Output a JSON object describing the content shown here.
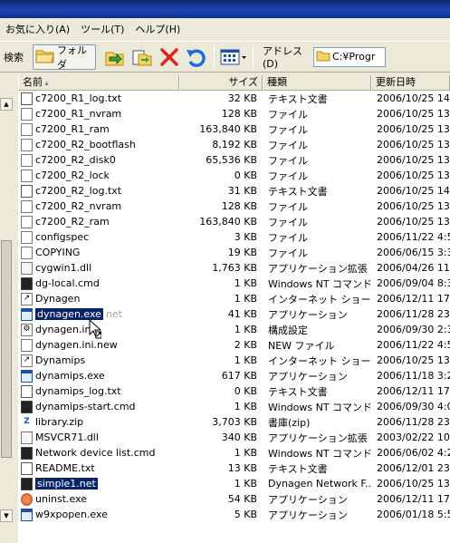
{
  "menu": [
    "お気に入り(A)",
    "ツール(T)",
    "ヘルプ(H)"
  ],
  "toolbar": {
    "search_label": "検索",
    "folders_label": "フォルダ",
    "address_label": "アドレス(D)",
    "address_value": "C:¥Progr"
  },
  "columns": {
    "name": "名前",
    "size": "サイズ",
    "type": "種類",
    "date": "更新日時"
  },
  "files": [
    {
      "name": "c7200_R1_log.txt",
      "size": "32 KB",
      "type": "テキスト文書",
      "date": "2006/10/25 14",
      "icon": "txt"
    },
    {
      "name": "c7200_R1_nvram",
      "size": "128 KB",
      "type": "ファイル",
      "date": "2006/10/25 13",
      "icon": "gen"
    },
    {
      "name": "c7200_R1_ram",
      "size": "163,840 KB",
      "type": "ファイル",
      "date": "2006/10/25 13",
      "icon": "gen"
    },
    {
      "name": "c7200_R2_bootflash",
      "size": "8,192 KB",
      "type": "ファイル",
      "date": "2006/10/25 13",
      "icon": "gen"
    },
    {
      "name": "c7200_R2_disk0",
      "size": "65,536 KB",
      "type": "ファイル",
      "date": "2006/10/25 13",
      "icon": "gen"
    },
    {
      "name": "c7200_R2_lock",
      "size": "0 KB",
      "type": "ファイル",
      "date": "2006/10/25 13",
      "icon": "gen"
    },
    {
      "name": "c7200_R2_log.txt",
      "size": "31 KB",
      "type": "テキスト文書",
      "date": "2006/10/25 14",
      "icon": "txt"
    },
    {
      "name": "c7200_R2_nvram",
      "size": "128 KB",
      "type": "ファイル",
      "date": "2006/10/25 13",
      "icon": "gen"
    },
    {
      "name": "c7200_R2_ram",
      "size": "163,840 KB",
      "type": "ファイル",
      "date": "2006/10/25 13",
      "icon": "gen"
    },
    {
      "name": "configspec",
      "size": "3 KB",
      "type": "ファイル",
      "date": "2006/11/22 4:5",
      "icon": "gen"
    },
    {
      "name": "COPYING",
      "size": "19 KB",
      "type": "ファイル",
      "date": "2006/06/15 3:3",
      "icon": "gen"
    },
    {
      "name": "cygwin1.dll",
      "size": "1,763 KB",
      "type": "アプリケーション拡張",
      "date": "2006/04/26 11",
      "icon": "dll"
    },
    {
      "name": "dg-local.cmd",
      "size": "1 KB",
      "type": "Windows NT コマンド...",
      "date": "2006/09/04 8:3",
      "icon": "cmd"
    },
    {
      "name": "Dynagen",
      "size": "1 KB",
      "type": "インターネット ショート...",
      "date": "2006/12/11 17",
      "icon": "lnk"
    },
    {
      "name": "dynagen.exe",
      "ghost": "net",
      "size": "41 KB",
      "type": "アプリケーション",
      "date": "2006/11/28 23",
      "icon": "app",
      "selected": true
    },
    {
      "name": "dynagen.ini",
      "size": "1 KB",
      "type": "構成設定",
      "date": "2006/09/30 2:3",
      "icon": "cfg"
    },
    {
      "name": "dynagen.ini.new",
      "size": "2 KB",
      "type": "NEW ファイル",
      "date": "2006/11/22 4:5",
      "icon": "gen"
    },
    {
      "name": "Dynamips",
      "size": "1 KB",
      "type": "インターネット ショート...",
      "date": "2006/10/25 13",
      "icon": "lnk"
    },
    {
      "name": "dynamips.exe",
      "size": "617 KB",
      "type": "アプリケーション",
      "date": "2006/11/18 3:2",
      "icon": "app"
    },
    {
      "name": "dynamips_log.txt",
      "size": "0 KB",
      "type": "テキスト文書",
      "date": "2006/12/11 17",
      "icon": "txt"
    },
    {
      "name": "dynamips-start.cmd",
      "size": "1 KB",
      "type": "Windows NT コマンド...",
      "date": "2006/09/30 4:0",
      "icon": "cmd"
    },
    {
      "name": "library.zip",
      "size": "3,703 KB",
      "type": "書庫(zip)",
      "date": "2006/11/28 23",
      "icon": "zip"
    },
    {
      "name": "MSVCR71.dll",
      "size": "340 KB",
      "type": "アプリケーション拡張",
      "date": "2003/02/22 10",
      "icon": "dll"
    },
    {
      "name": "Network device list.cmd",
      "size": "1 KB",
      "type": "Windows NT コマンド...",
      "date": "2006/06/02 4:2",
      "icon": "cmd"
    },
    {
      "name": "README.txt",
      "size": "13 KB",
      "type": "テキスト文書",
      "date": "2006/12/01 23",
      "icon": "txt"
    },
    {
      "name": "simple1.net",
      "size": "1 KB",
      "type": "Dynagen Network F...",
      "date": "2006/10/25 13",
      "icon": "cmd",
      "selected": true
    },
    {
      "name": "uninst.exe",
      "size": "54 KB",
      "type": "アプリケーション",
      "date": "2006/12/11 17",
      "icon": "uni"
    },
    {
      "name": "w9xpopen.exe",
      "size": "5 KB",
      "type": "アプリケーション",
      "date": "2006/01/18 5:5",
      "icon": "app"
    }
  ]
}
